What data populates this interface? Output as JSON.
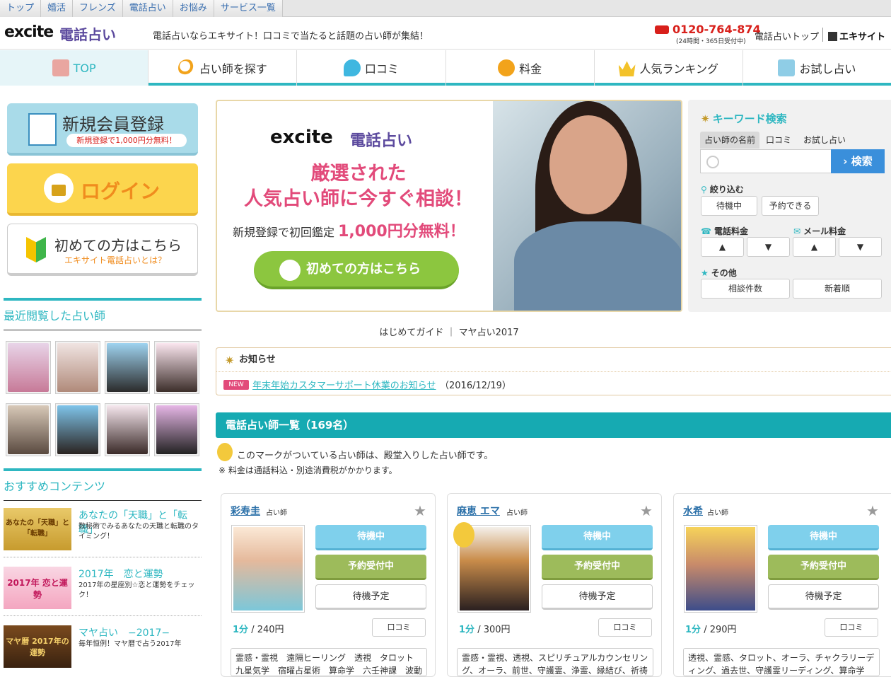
{
  "topbar": {
    "items": [
      "トップ",
      "婚活",
      "フレンズ",
      "電話占い",
      "お悩み",
      "サービス一覧"
    ]
  },
  "header": {
    "logo": "excite",
    "logo_sub": "電話占い",
    "tagline": "電話占いならエキサイト！口コミで当たると話題の占い師が集結！",
    "phone": "0120-764-874",
    "phone_note": "(24時間・365日受付中)",
    "link_top": "電話占いトップ",
    "link_home": "エキサイト"
  },
  "nav": {
    "items": [
      "TOP",
      "占い師を探す",
      "口コミ",
      "料金",
      "人気ランキング",
      "お試し占い"
    ]
  },
  "left": {
    "register": {
      "title": "新規会員登録",
      "sub": "新規登録で1,000円分無料！"
    },
    "login": {
      "title": "ログイン"
    },
    "first": {
      "title": "初めての方はこちら",
      "sub": "エキサイト電話占いとは？"
    },
    "recent_title": "最近閲覧した占い師",
    "recommend_title": "おすすめコンテンツ",
    "recommend": [
      {
        "title": "あなたの「天職」と「転職」",
        "desc": "数秘術でみるあなたの天職と転職のタイミング！",
        "img_text": "あなたの「天職」と「転職」"
      },
      {
        "title": "2017年　恋と運勢",
        "desc": "2017年の星座別☆恋と運勢をチェック！",
        "img_text": "2017年 恋と運勢"
      },
      {
        "title": "マヤ占い　−2017−",
        "desc": "毎年恒例！マヤ暦で占う2017年",
        "img_text": "マヤ暦 2017年の運勢"
      }
    ]
  },
  "banner": {
    "logo": "excite",
    "logo_sub": "電話占い",
    "headline1": "厳選された",
    "headline2": "人気占い師に今すぐ相談！",
    "sub_prefix": "新規登録で初回鑑定",
    "sub_emph": "1,000円分無料！",
    "button": "初めての方はこちら"
  },
  "guide": "はじめてガイド ｜ マヤ占い2017",
  "news": {
    "title": "お知らせ",
    "tag": "NEW",
    "link": "年末年始カスタマーサポート休業のお知らせ",
    "date": "（2016/12/19）"
  },
  "list": {
    "header": "電話占い師一覧（169名）",
    "mark_note": "このマークがついている占い師は、殿堂入りした占い師です。",
    "fee_note": "※ 料金は通話料込・別途消費税がかかります。"
  },
  "cards": [
    {
      "name": "彩寿圭",
      "role": "占い師",
      "btn1": "待機中",
      "btn2": "予約受付中",
      "btn3": "待機予定",
      "price_time": "1分",
      "price": "/ 240円",
      "review": "口コミ",
      "tags": "霊感・霊視　遠隔ヒーリング　透視　タロット　九星気学　宿曜占星術　算命学　六壬神課　波動修"
    },
    {
      "name": "麻恵 エマ",
      "role": "占い師",
      "btn1": "待機中",
      "btn2": "予約受付中",
      "btn3": "待機予定",
      "price_time": "1分",
      "price": "/ 300円",
      "review": "口コミ",
      "tags": "霊感・霊視、透視、スピリチュアルカウンセリング、オーラ、前世、守護霊、浄霊、縁結び、祈祷術"
    },
    {
      "name": "水希",
      "role": "占い師",
      "btn1": "待機中",
      "btn2": "予約受付中",
      "btn3": "待機予定",
      "price_time": "1分",
      "price": "/ 290円",
      "review": "口コミ",
      "tags": "透視、霊感、タロット、オーラ、チャクラリーディング、過去世、守護霊リーディング、算命学"
    }
  ],
  "search": {
    "title": "キーワード検索",
    "tabs": [
      "占い師の名前",
      "口コミ",
      "お試し占い"
    ],
    "button": "検索",
    "filter_label": "絞り込む",
    "filter_buttons": [
      "待機中",
      "予約できる"
    ],
    "phone_fee": "電話料金",
    "mail_fee": "メール料金",
    "asc": "▲",
    "desc": "▼",
    "other_label": "その他",
    "other_buttons": [
      "相談件数",
      "新着順"
    ]
  },
  "colors": {
    "accent": "#2eb7c1",
    "brand_red": "#d8201b",
    "pink": "#e24a7a"
  }
}
